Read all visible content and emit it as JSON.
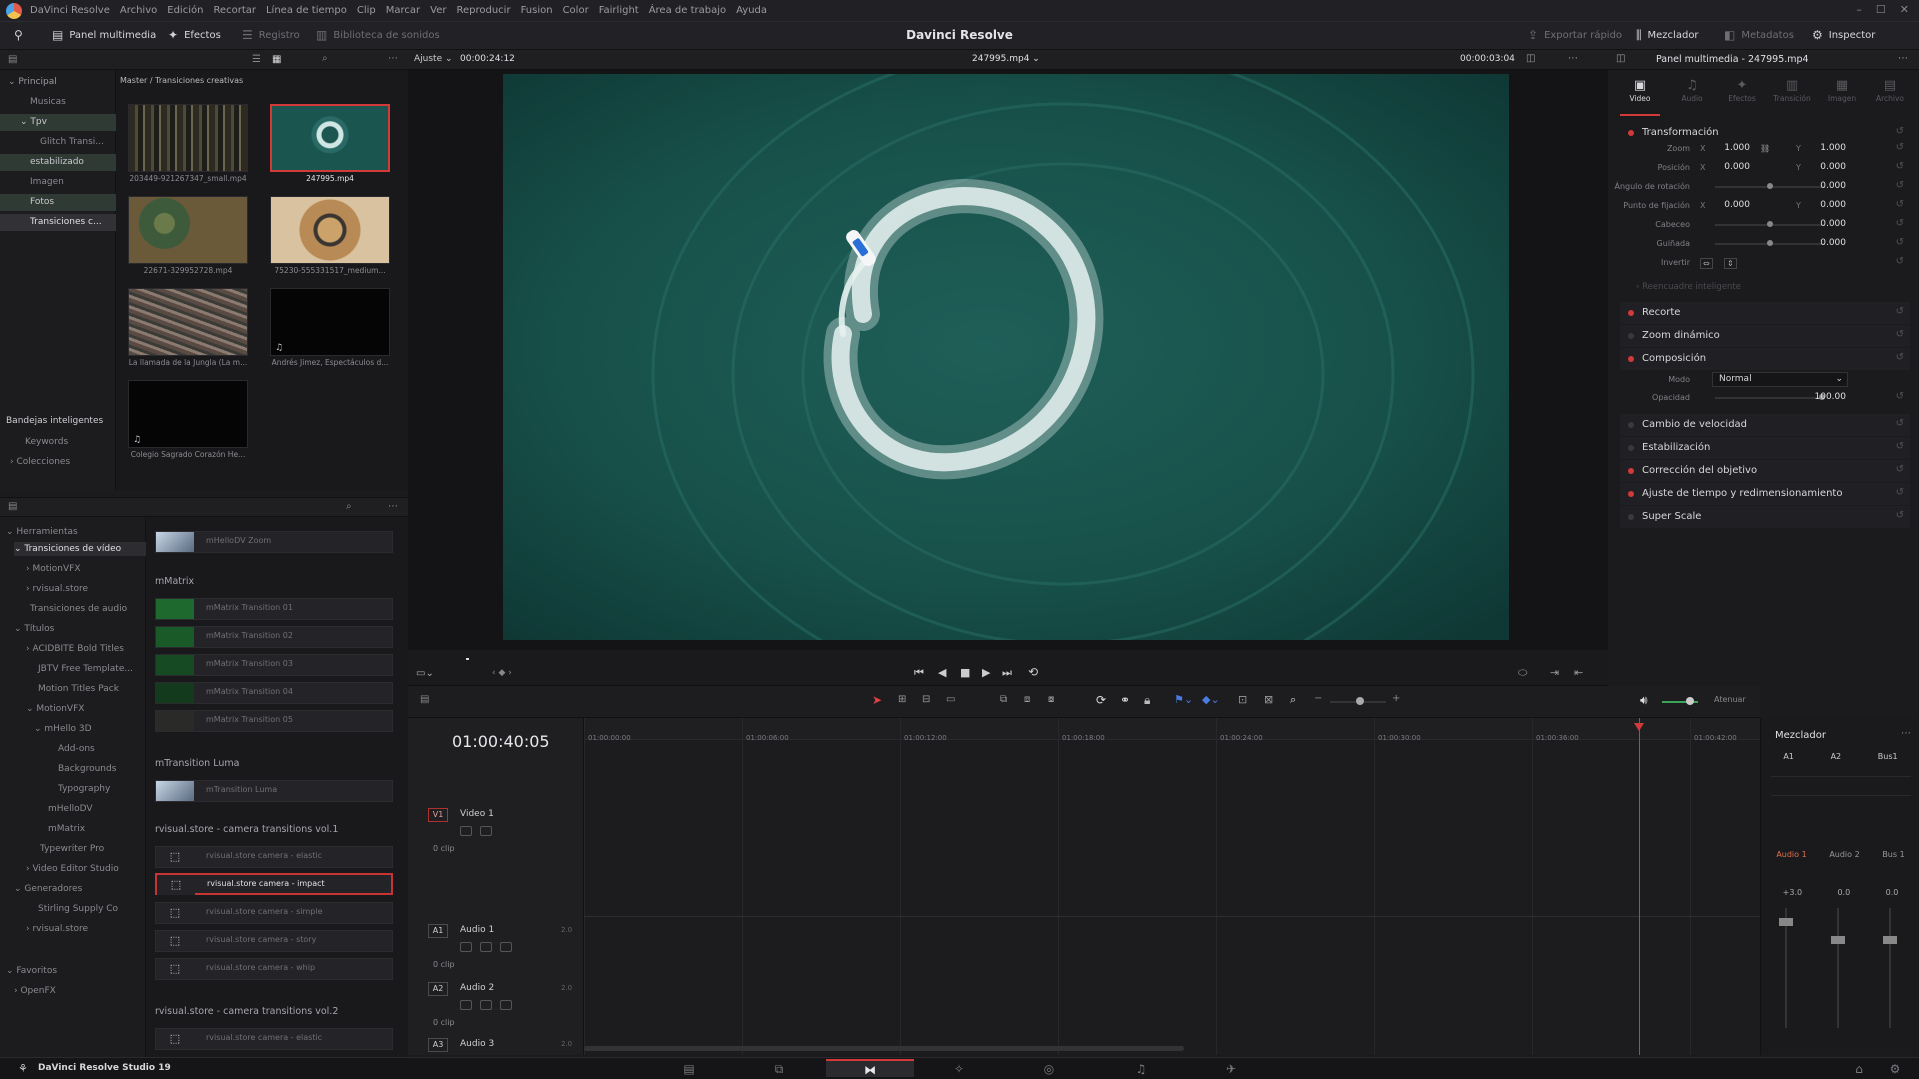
{
  "menu": {
    "items": [
      "DaVinci Resolve",
      "Archivo",
      "Edición",
      "Recortar",
      "Línea de tiempo",
      "Clip",
      "Marcar",
      "Ver",
      "Reproducir",
      "Fusion",
      "Color",
      "Fairlight",
      "Área de trabajo",
      "Ayuda"
    ]
  },
  "toolbar": {
    "media_pool": "Panel multimedia",
    "effects": "Efectos",
    "index": "Registro",
    "sound_library": "Biblioteca de sonidos",
    "app_title": "Davinci Resolve",
    "quick_export": "Exportar rápido",
    "mixer": "Mezclador",
    "metadata": "Metadatos",
    "inspector": "Inspector"
  },
  "media_pool": {
    "breadcrumb": "Master / Transiciones creativas",
    "bins": [
      "Principal",
      "Musicas",
      "Tpv",
      "Glitch Transi...",
      "estabilizado",
      "Imagen",
      "Fotos",
      "Transiciones c..."
    ],
    "smart_bins_title": "Bandejas inteligentes",
    "smart_bins": [
      "Keywords",
      "Colecciones"
    ],
    "clips": [
      {
        "name": "203449-921267347_small.mp4"
      },
      {
        "name": "247995.mp4"
      },
      {
        "name": "22671-329952728.mp4"
      },
      {
        "name": "75230-555331517_medium..."
      },
      {
        "name": "La llamada de la Jungla (La m..."
      },
      {
        "name": "Andrés Jimez, Espectáculos d..."
      },
      {
        "name": "Colegio Sagrado Corazón He..."
      }
    ]
  },
  "effects": {
    "tree": [
      "Herramientas",
      "Transiciones de vídeo",
      "MotionVFX",
      "rvisual.store",
      "Transiciones de audio",
      "Títulos",
      "ACIDBITE Bold Titles",
      "JBTV Free Template...",
      "Motion Titles Pack",
      "MotionVFX",
      "mHello 3D",
      "Add-ons",
      "Backgrounds",
      "Typography",
      "mHelloDV",
      "mMatrix",
      "Typewriter Pro",
      "Video Editor Studio",
      "Generadores",
      "Stirling Supply Co",
      "rvisual.store",
      "Favoritos",
      "OpenFX"
    ],
    "top_item": "mHelloDV Zoom",
    "groups": [
      {
        "title": "mMatrix",
        "items": [
          "mMatrix Transition 01",
          "mMatrix Transition 02",
          "mMatrix Transition 03",
          "mMatrix Transition 04",
          "mMatrix Transition 05"
        ]
      },
      {
        "title": "mTransition Luma",
        "items": [
          "mTransition Luma"
        ]
      },
      {
        "title": "rvisual.store - camera transitions vol.1",
        "items": [
          "rvisual.store camera - elastic",
          "rvisual.store camera - impact",
          "rvisual.store camera - simple",
          "rvisual.store camera - story",
          "rvisual.store camera - whip"
        ]
      },
      {
        "title": "rvisual.store - camera transitions vol.2",
        "items": [
          "rvisual.store camera - elastic"
        ]
      }
    ]
  },
  "viewer": {
    "fit_label": "Ajuste",
    "source_timecode": "00:00:24:12",
    "clip_name": "247995.mp4",
    "duration": "00:00:03:04"
  },
  "timeline": {
    "timecode": "01:00:40:05",
    "ruler": [
      "01:00:00:00",
      "01:00:06:00",
      "01:00:12:00",
      "01:00:18:00",
      "01:00:24:00",
      "01:00:30:00",
      "01:00:36:00",
      "01:00:42:00"
    ],
    "tracks": [
      {
        "id": "V1",
        "name": "Video 1",
        "count": "0 clip"
      },
      {
        "id": "A1",
        "name": "Audio 1",
        "count": "0 clip",
        "db": "2.0"
      },
      {
        "id": "A2",
        "name": "Audio 2",
        "count": "0 clip",
        "db": "2.0"
      },
      {
        "id": "A3",
        "name": "Audio 3",
        "db": "2.0"
      }
    ],
    "dim_label": "Atenuar"
  },
  "inspector": {
    "title": "Panel multimedia - 247995.mp4",
    "tabs": [
      "Video",
      "Audio",
      "Efectos",
      "Transición",
      "Imagen",
      "Archivo"
    ],
    "transform": {
      "title": "Transformación",
      "zoom_label": "Zoom",
      "zoom_x": "1.000",
      "zoom_y": "1.000",
      "position_label": "Posición",
      "pos_x": "0.000",
      "pos_y": "0.000",
      "rotation_label": "Ángulo de rotación",
      "rotation": "0.000",
      "anchor_label": "Punto de fijación",
      "anchor_x": "0.000",
      "anchor_y": "0.000",
      "pitch_label": "Cabeceo",
      "pitch": "0.000",
      "yaw_label": "Guiñada",
      "yaw": "0.000",
      "flip_label": "Invertir"
    },
    "smart_reframe": "Reencuadre inteligente",
    "sections": [
      "Recorte",
      "Zoom dinámico",
      "Composición"
    ],
    "composite": {
      "mode_label": "Modo",
      "mode": "Normal",
      "opacity_label": "Opacidad",
      "opacity": "100.00"
    },
    "more_sections": [
      "Cambio de velocidad",
      "Estabilización",
      "Corrección del objetivo",
      "Ajuste de tiempo y redimensionamiento",
      "Super Scale"
    ]
  },
  "mixer": {
    "title": "Mezclador",
    "channels": [
      "A1",
      "A2",
      "Bus1"
    ],
    "strips": [
      "Audio 1",
      "Audio 2",
      "Bus 1"
    ],
    "levels": [
      "+3.0",
      "0.0",
      "0.0"
    ]
  },
  "status": {
    "product": "DaVinci Resolve Studio 19"
  }
}
